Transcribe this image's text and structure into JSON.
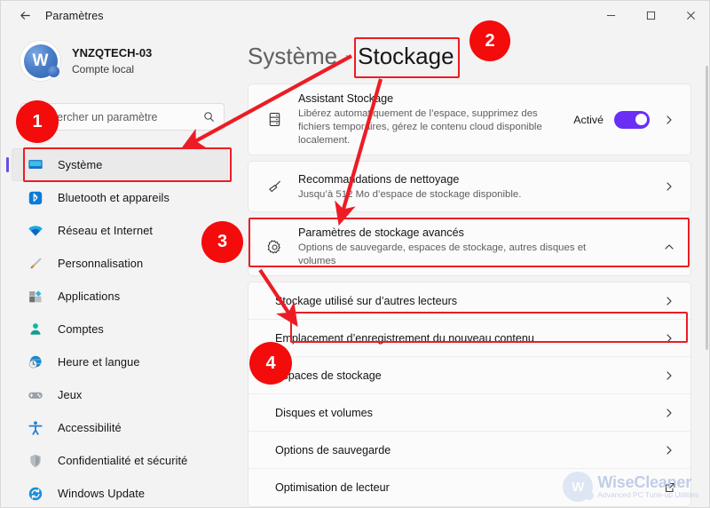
{
  "window": {
    "title": "Paramètres",
    "back_icon": "back-arrow-icon",
    "minimize_label": "–",
    "maximize_label": "□",
    "close_label": "✕"
  },
  "account": {
    "avatar_letter": "W",
    "name": "YNZQTECH-03",
    "type": "Compte local"
  },
  "search": {
    "placeholder": "Rechercher un paramètre",
    "icon": "search-icon"
  },
  "sidebar": {
    "items": [
      {
        "label": "Système",
        "icon": "monitor-icon",
        "active": true
      },
      {
        "label": "Bluetooth et appareils",
        "icon": "bluetooth-icon",
        "active": false
      },
      {
        "label": "Réseau et Internet",
        "icon": "wifi-icon",
        "active": false
      },
      {
        "label": "Personnalisation",
        "icon": "paintbrush-icon",
        "active": false
      },
      {
        "label": "Applications",
        "icon": "apps-icon",
        "active": false
      },
      {
        "label": "Comptes",
        "icon": "person-icon",
        "active": false
      },
      {
        "label": "Heure et langue",
        "icon": "clock-globe-icon",
        "active": false
      },
      {
        "label": "Jeux",
        "icon": "gamepad-icon",
        "active": false
      },
      {
        "label": "Accessibilité",
        "icon": "accessibility-icon",
        "active": false
      },
      {
        "label": "Confidentialité et sécurité",
        "icon": "shield-icon",
        "active": false
      },
      {
        "label": "Windows Update",
        "icon": "update-icon",
        "active": false
      }
    ]
  },
  "main": {
    "breadcrumb_parent": "Système",
    "breadcrumb_separator": "›",
    "breadcrumb_current": "Stockage",
    "cards": [
      {
        "title": "Assistant Stockage",
        "subtitle": "Libérez automatiquement de l’espace, supprimez des fichiers temporaires, gérez le contenu cloud disponible localement.",
        "icon": "storage-drive-icon",
        "toggle_label": "Activé",
        "toggle_on": true,
        "chevron": "chevron-right-icon"
      },
      {
        "title": "Recommandations de nettoyage",
        "subtitle": "Jusqu’à 512 Mo d’espace de stockage disponible.",
        "icon": "broom-icon",
        "chevron": "chevron-right-icon"
      },
      {
        "title": "Paramètres de stockage avancés",
        "subtitle": "Options de sauvegarde, espaces de stockage, autres disques et volumes",
        "icon": "gear-icon",
        "chevron": "chevron-up-icon"
      }
    ],
    "sub_items": [
      {
        "label": "Stockage utilisé sur d’autres lecteurs",
        "chevron": "chevron-right-icon",
        "external": false
      },
      {
        "label": "Emplacement d’enregistrement du nouveau contenu",
        "chevron": "chevron-right-icon",
        "external": false
      },
      {
        "label": "Espaces de stockage",
        "chevron": "chevron-right-icon",
        "external": false
      },
      {
        "label": "Disques et volumes",
        "chevron": "chevron-right-icon",
        "external": false
      },
      {
        "label": "Options de sauvegarde",
        "chevron": "chevron-right-icon",
        "external": false
      },
      {
        "label": "Optimisation de lecteur",
        "chevron": "",
        "external": true
      }
    ]
  },
  "annotations": {
    "color": "#ed1c24",
    "badge_color": "#f40b0b",
    "steps": [
      {
        "number": "1",
        "target": "sidebar-item-systeme"
      },
      {
        "number": "2",
        "target": "breadcrumb-stockage"
      },
      {
        "number": "3",
        "target": "advanced-storage-settings-row"
      },
      {
        "number": "4",
        "target": "new-content-save-location-row"
      }
    ]
  },
  "watermark": {
    "logo_letter": "W",
    "name": "WiseCleaner",
    "tagline": "Advanced PC Tune-up Utilities"
  }
}
